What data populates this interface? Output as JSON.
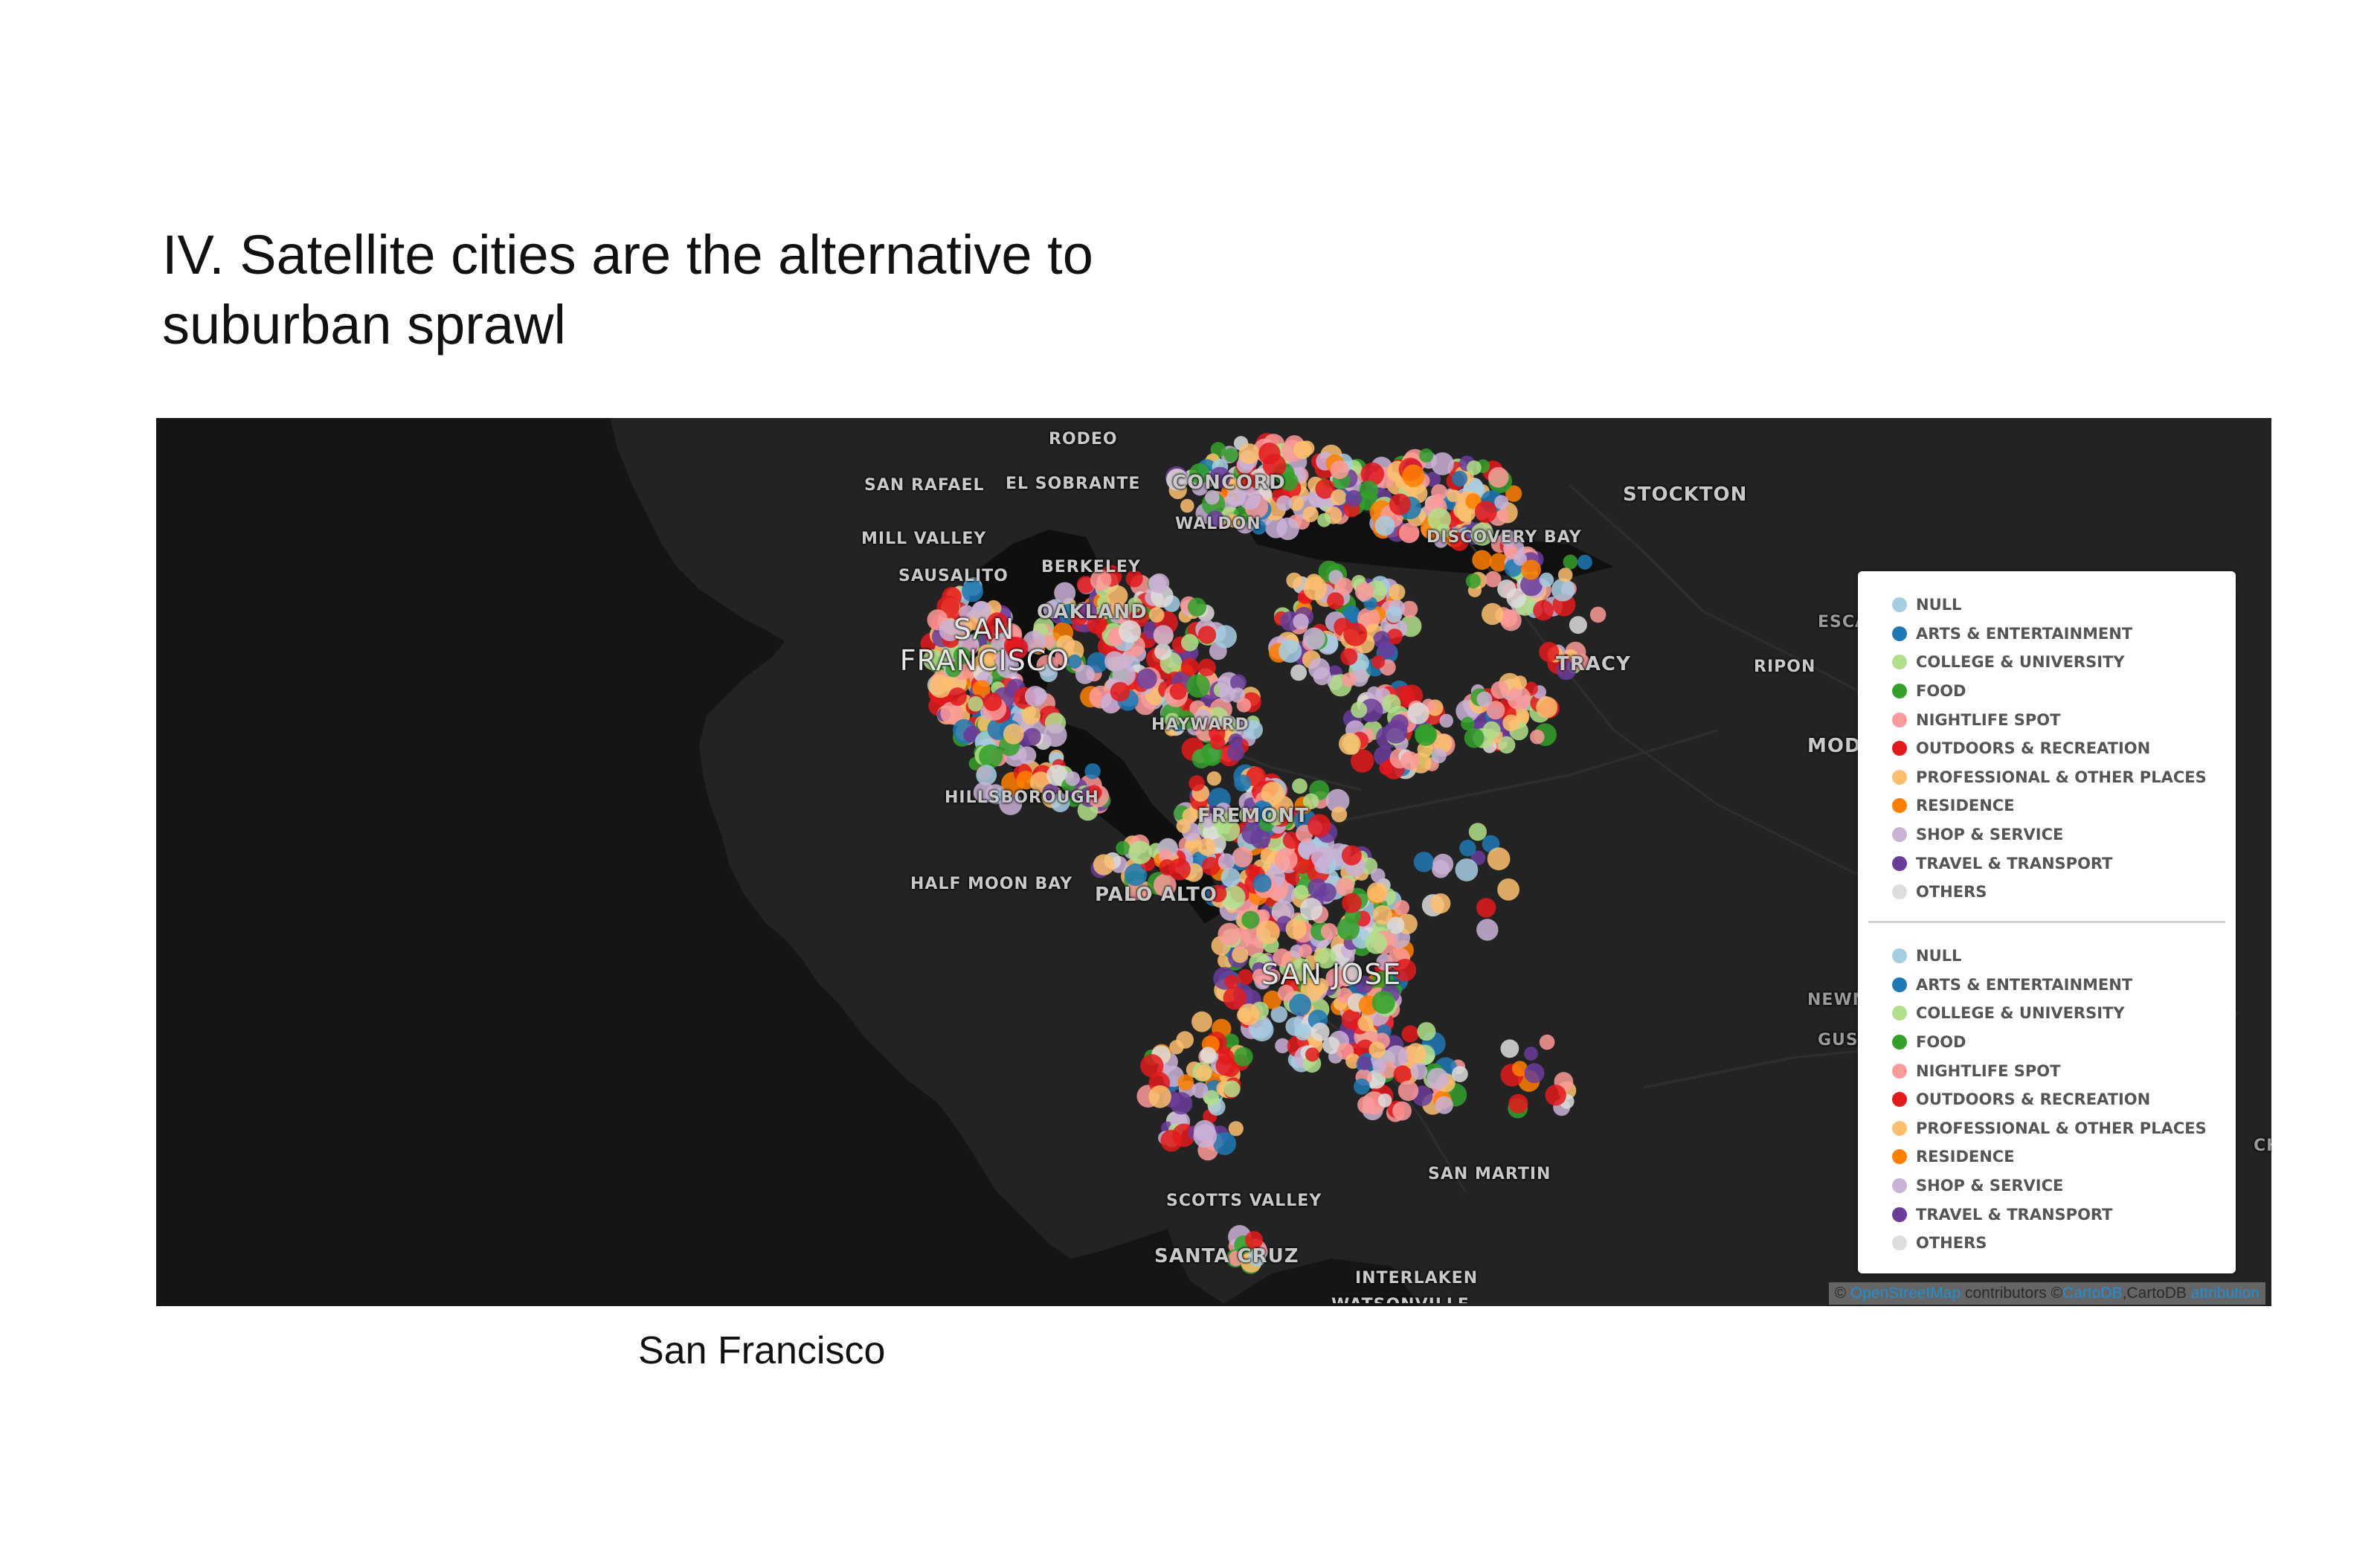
{
  "slide": {
    "title_line1": "IV. Satellite cities are the alternative to",
    "title_line2": "suburban sprawl",
    "caption": "San Francisco"
  },
  "map": {
    "basemap_style": "dark",
    "colors": {
      "land": "#232323",
      "ocean": "#151515",
      "bay": "#0e0e0e",
      "roads": "#2b2b2b"
    },
    "place_labels": {
      "rodeo": "RODEO",
      "san_rafael": "SAN RAFAEL",
      "el_sobrante": "EL SOBRANTE",
      "concord": "CONCORD",
      "stockton": "STOCKTON",
      "mill_valley": "MILL VALLEY",
      "walnut_creek": "WALDON",
      "discovery_bay": "DISCOVERY BAY",
      "sausalito": "SAUSALITO",
      "berkeley": "BERKELEY",
      "oakland": "OAKLAND",
      "escalon": "ESCA",
      "san_francisco_1": "SAN",
      "san_francisco_2": "FRANCISCO",
      "tracy": "TRACY",
      "ripon": "RIPON",
      "hayward": "HAYWARD",
      "modesto": "MOD",
      "hillsborough": "HILLSBOROUGH",
      "fremont": "FREMONT",
      "half_moon_bay": "HALF MOON BAY",
      "palo_alto": "PALO ALTO",
      "san_jose": "SAN JOSE",
      "newman": "NEWM",
      "gustine": "GUST",
      "ch": "CH",
      "san_martin": "SAN MARTIN",
      "scotts_valley": "SCOTTS VALLEY",
      "santa_cruz": "SANTA CRUZ",
      "interlaken": "INTERLAKEN",
      "watsonville": "WATSONVILLE"
    },
    "legend_groups": [
      [
        {
          "label": "NULL",
          "color": "#a6cee3"
        },
        {
          "label": "ARTS & ENTERTAINMENT",
          "color": "#1f78b4"
        },
        {
          "label": "COLLEGE & UNIVERSITY",
          "color": "#b2df8a"
        },
        {
          "label": "FOOD",
          "color": "#33a02c"
        },
        {
          "label": "NIGHTLIFE SPOT",
          "color": "#fb9a99"
        },
        {
          "label": "OUTDOORS & RECREATION",
          "color": "#e31a1c"
        },
        {
          "label": "PROFESSIONAL & OTHER PLACES",
          "color": "#fdbf6f"
        },
        {
          "label": "RESIDENCE",
          "color": "#ff7f00"
        },
        {
          "label": "SHOP & SERVICE",
          "color": "#cab2d6"
        },
        {
          "label": "TRAVEL & TRANSPORT",
          "color": "#6a3d9a"
        },
        {
          "label": "OTHERS",
          "color": "#dddddd"
        }
      ],
      [
        {
          "label": "NULL",
          "color": "#a6cee3"
        },
        {
          "label": "ARTS & ENTERTAINMENT",
          "color": "#1f78b4"
        },
        {
          "label": "COLLEGE & UNIVERSITY",
          "color": "#b2df8a"
        },
        {
          "label": "FOOD",
          "color": "#33a02c"
        },
        {
          "label": "NIGHTLIFE SPOT",
          "color": "#fb9a99"
        },
        {
          "label": "OUTDOORS & RECREATION",
          "color": "#e31a1c"
        },
        {
          "label": "PROFESSIONAL & OTHER PLACES",
          "color": "#fdbf6f"
        },
        {
          "label": "RESIDENCE",
          "color": "#ff7f00"
        },
        {
          "label": "SHOP & SERVICE",
          "color": "#cab2d6"
        },
        {
          "label": "TRAVEL & TRANSPORT",
          "color": "#6a3d9a"
        },
        {
          "label": "OTHERS",
          "color": "#dddddd"
        }
      ]
    ],
    "attribution": {
      "prefix": "©",
      "osm_link": "OpenStreetMap",
      "contributors": "contributors ©",
      "cartodb_link": "CartoDB",
      "cartodb_text": ",CartoDB",
      "attribution_link": "attribution"
    }
  }
}
